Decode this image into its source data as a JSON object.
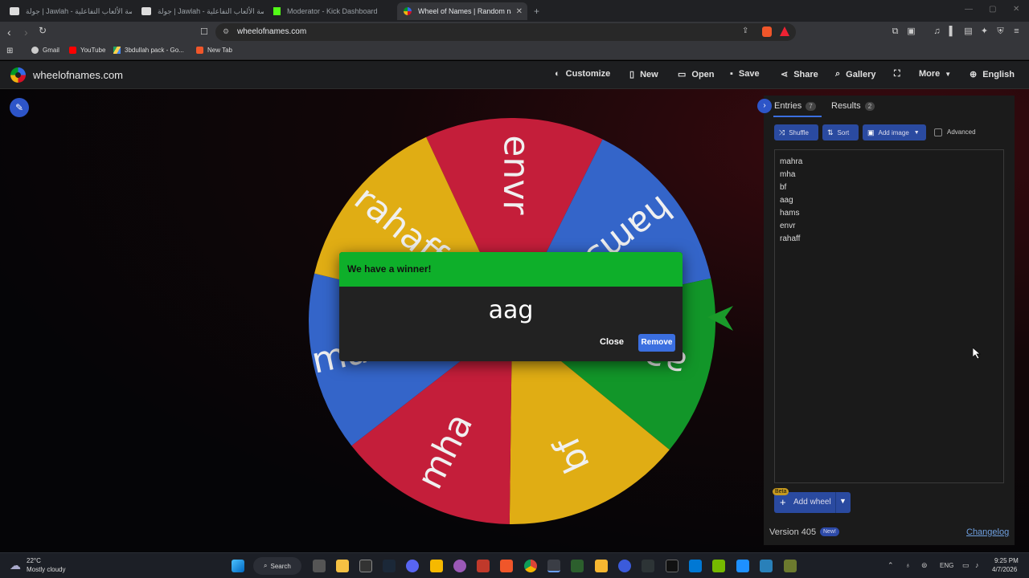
{
  "browser": {
    "tabs": [
      {
        "title": "جولة | Jawlah - منصة الألعاب التفاعلية",
        "active": false
      },
      {
        "title": "جولة | Jawlah - منصة الألعاب التفاعلية",
        "active": false
      },
      {
        "title": "Moderator - Kick Dashboard",
        "active": false
      },
      {
        "title": "Wheel of Names | Random name picker",
        "active": true
      }
    ],
    "new_tab": "+",
    "url": "wheelofnames.com",
    "bookmarks": [
      "Gmail",
      "YouTube",
      "3bdullah pack - Go...",
      "New Tab"
    ]
  },
  "app": {
    "site_title": "wheelofnames.com",
    "menu": [
      "Customize",
      "New",
      "Open",
      "Save",
      "Share",
      "Gallery",
      "More",
      "English"
    ]
  },
  "wheel": {
    "segments": [
      {
        "label": "envr",
        "color": "#c41e3a"
      },
      {
        "label": "hams",
        "color": "#3465c9"
      },
      {
        "label": "aag",
        "color": "#129629"
      },
      {
        "label": "bf",
        "color": "#e0ad14"
      },
      {
        "label": "mha",
        "color": "#c41e3a"
      },
      {
        "label": "mahra",
        "color": "#3465c9"
      },
      {
        "label": "rahaff",
        "color": "#e0ad14"
      }
    ],
    "pointer_color": "#1a9a2a"
  },
  "dialog": {
    "title": "We have a winner!",
    "winner": "aag",
    "close_label": "Close",
    "remove_label": "Remove"
  },
  "panel": {
    "entries_tab": "Entries",
    "entries_count": "7",
    "results_tab": "Results",
    "results_count": "2",
    "shuffle_label": "Shuffle",
    "sort_label": "Sort",
    "add_image_label": "Add image",
    "advanced_label": "Advanced",
    "entries": [
      "mahra",
      "mha",
      "bf",
      "aag",
      "hams",
      "envr",
      "rahaff"
    ],
    "beta_badge": "Beta",
    "add_wheel_label": "Add wheel",
    "version": "Version 405",
    "new_badge": "New!",
    "changelog": "Changelog"
  },
  "taskbar": {
    "weather_temp": "22°C",
    "weather_desc": "Mostly cloudy",
    "search_label": "Search",
    "language": "ENG",
    "time": "9:25 PM",
    "date": "4/7/2026"
  }
}
